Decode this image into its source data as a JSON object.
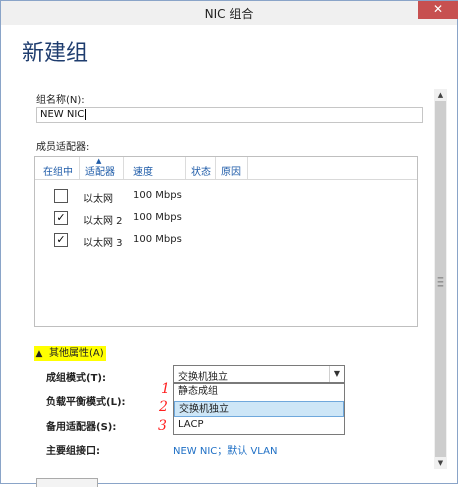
{
  "window": {
    "title": "NIC 组合",
    "close_label": "✕",
    "heading": "新建组"
  },
  "team_name": {
    "label": "组名称(N):",
    "value": "NEW NIC"
  },
  "members": {
    "label": "成员适配器:",
    "columns": [
      "在组中",
      "适配器",
      "速度",
      "状态",
      "原因"
    ],
    "rows": [
      {
        "checked": false,
        "adapter": "以太网",
        "speed": "100 Mbps",
        "status": "",
        "reason": ""
      },
      {
        "checked": true,
        "adapter": "以太网 2",
        "speed": "100 Mbps",
        "status": "",
        "reason": ""
      },
      {
        "checked": true,
        "adapter": "以太网 3",
        "speed": "100 Mbps",
        "status": "",
        "reason": ""
      }
    ]
  },
  "more_properties": {
    "label": "其他属性(A)",
    "expanded": true
  },
  "properties": {
    "teaming_mode": {
      "label": "成组模式(T):",
      "value": "交换机独立"
    },
    "load_balancing": {
      "label": "负载平衡模式(L):"
    },
    "standby_adapter": {
      "label": "备用适配器(S):"
    },
    "primary_interface": {
      "label": "主要组接口:",
      "link": "NEW NIC；默认 VLAN"
    }
  },
  "dropdown": {
    "options": [
      "静态成组",
      "交换机独立",
      "LACP"
    ],
    "highlighted_index": 1
  },
  "annotations": [
    "1",
    "2",
    "3"
  ],
  "colors": {
    "heading": "#1e3c6e",
    "link": "#1e6fc5",
    "highlight": "#ffff00",
    "annotation": "#ff2020",
    "selected_option": "#cde6f7"
  }
}
